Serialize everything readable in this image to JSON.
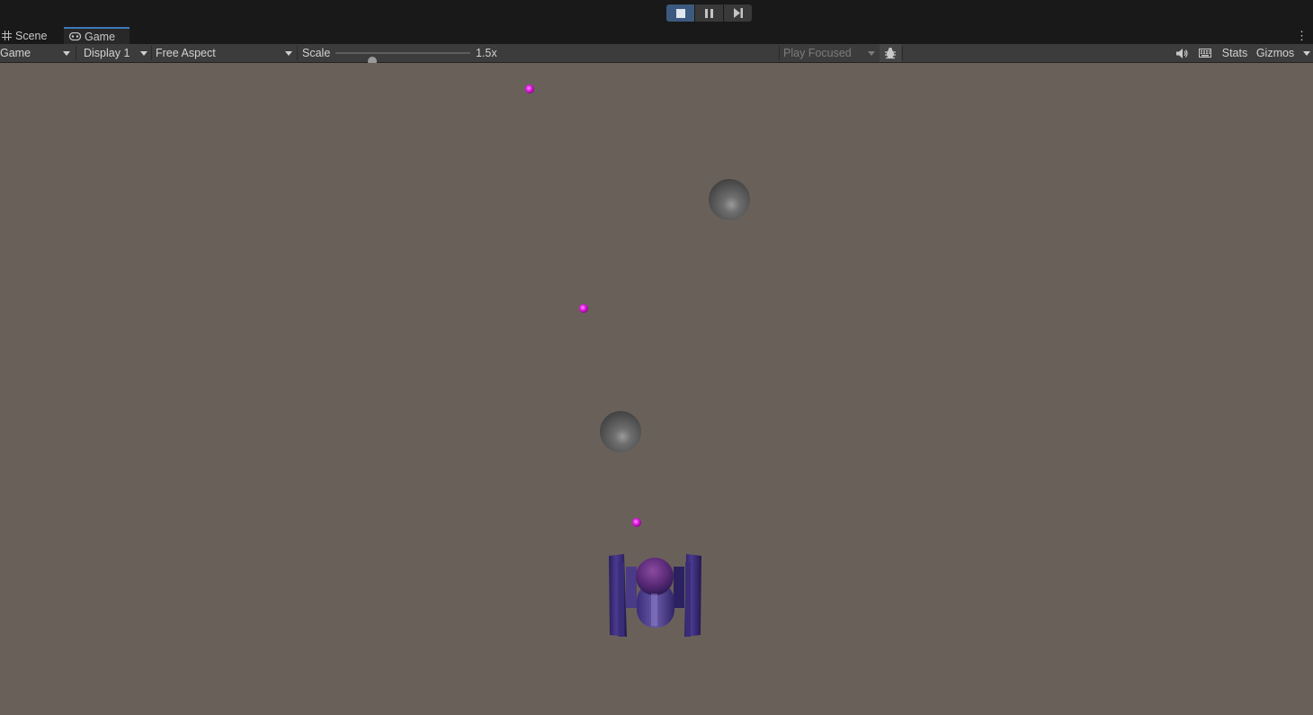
{
  "playbar": {
    "buttons": [
      {
        "name": "play-stop-button",
        "icon": "stop-icon",
        "active": true
      },
      {
        "name": "pause-button",
        "icon": "pause-icon",
        "active": false
      },
      {
        "name": "step-button",
        "icon": "step-icon",
        "active": false
      }
    ]
  },
  "tabs": [
    {
      "label": "Scene",
      "icon": "grid-icon",
      "active": false
    },
    {
      "label": "Game",
      "icon": "gamepad-icon",
      "active": true
    }
  ],
  "toolbar": {
    "mode_select": "Game",
    "display_select": "Display 1",
    "aspect_select": "Free Aspect",
    "scale_label": "Scale",
    "scale_value": "1.5x",
    "scale_level": 0.27,
    "play_mode_select": "Play Focused",
    "debug_icon": "bug-icon",
    "audio_icon": "speaker-icon",
    "keyboard_icon": "keyboard-icon",
    "stats_label": "Stats",
    "gizmos_label": "Gizmos"
  },
  "game_view": {
    "background_color": "#6a605a",
    "projectile_color": "#e81ce8",
    "asteroid_color": "#6d6d6d",
    "ship_color": "#3b2b7a"
  }
}
